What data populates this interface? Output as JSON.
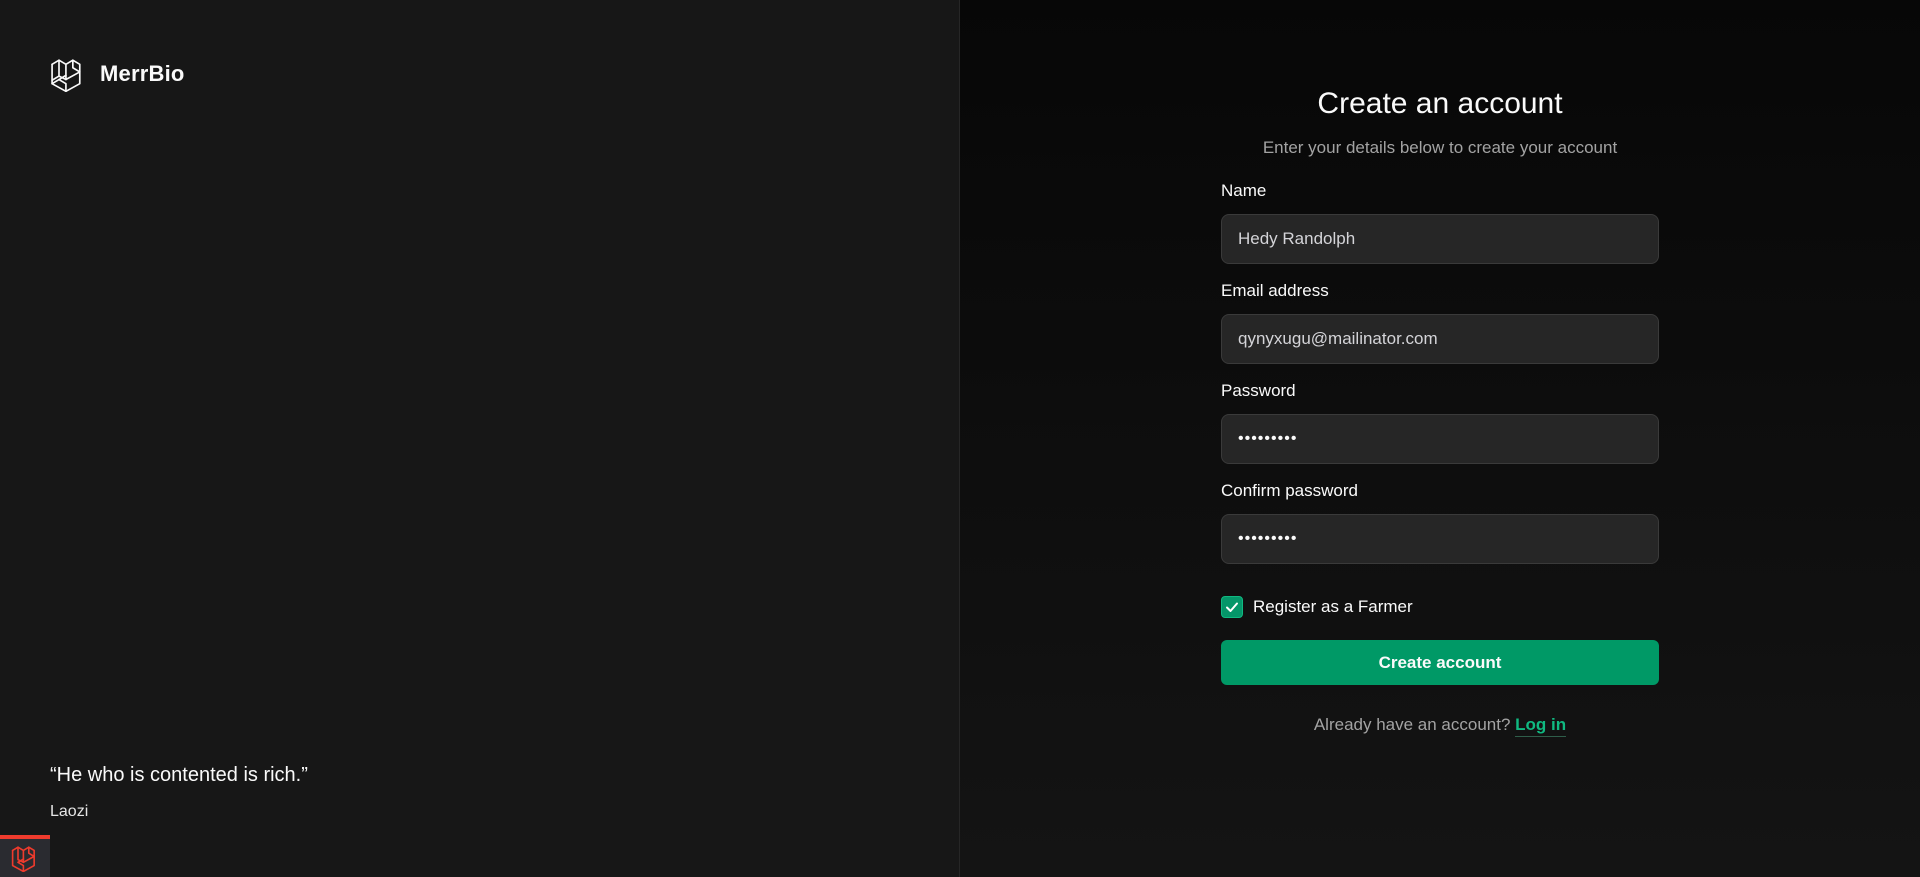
{
  "brand": {
    "name": "MerrBio",
    "logo_icon": "laravel-logo-icon"
  },
  "quote": {
    "text": "“He who is contented is rich.”",
    "author": "Laozi"
  },
  "form": {
    "title": "Create an account",
    "subtitle": "Enter your details below to create your account",
    "fields": [
      {
        "label": "Name",
        "value": "Hedy Randolph",
        "type": "text"
      },
      {
        "label": "Email address",
        "value": "qynyxugu@mailinator.com",
        "type": "email"
      },
      {
        "label": "Password",
        "value": "•••••••••",
        "type": "password"
      },
      {
        "label": "Confirm password",
        "value": "•••••••••",
        "type": "password"
      }
    ],
    "farmer_checkbox": {
      "label": "Register as a Farmer",
      "checked": true
    },
    "submit_label": "Create account",
    "login_prompt": "Already have an account?",
    "login_link": "Log in"
  },
  "colors": {
    "accent": "#009966",
    "link": "#10b981",
    "badge_border": "#ef3b2d"
  }
}
